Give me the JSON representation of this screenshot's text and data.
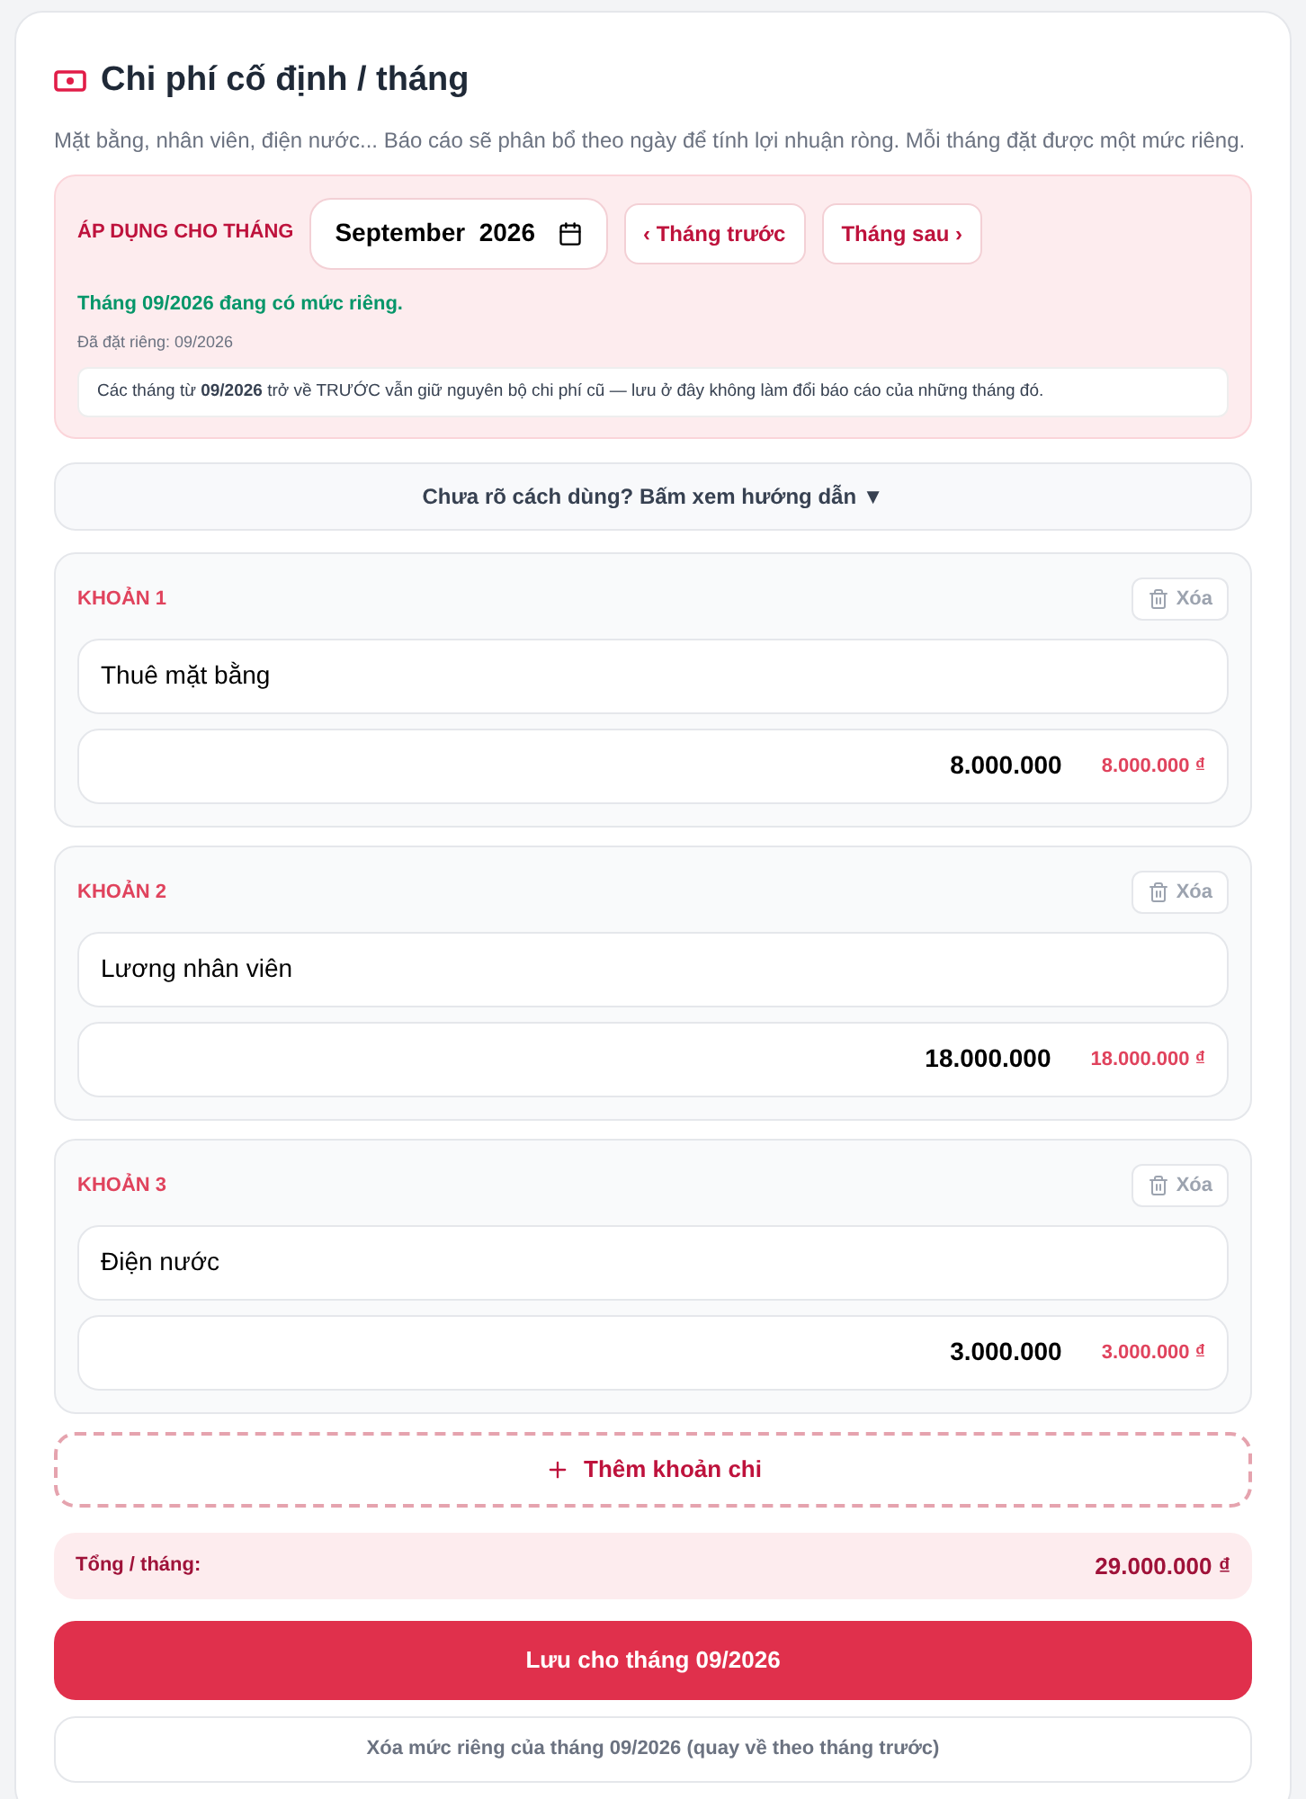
{
  "title": "Chi phí cố định / tháng",
  "description": "Mặt bằng, nhân viên, điện nước... Báo cáo sẽ phân bổ theo ngày để tính lợi nhuận ròng. Mỗi tháng đặt được một mức riêng.",
  "month_panel": {
    "label": "ÁP DỤNG CHO THÁNG",
    "month_value": "September  2026",
    "prev_button": "‹ Tháng trước",
    "next_button": "Tháng sau ›",
    "status": "Tháng 09/2026 đang có mức riêng.",
    "set_note": "Đã đặt riêng: 09/2026",
    "notice": "Các tháng từ **09/2026** trở về TRƯỚC vẫn giữ nguyên bộ chi phí cũ — lưu ở đây không làm đổi báo cáo của những tháng đó."
  },
  "guide_toggle": {
    "label": "Chưa rõ cách dùng? Bấm xem hướng dẫn ▼"
  },
  "items": [
    {
      "label": "KHOẢN 1",
      "delete": "Xóa",
      "name": "Thuê mặt bằng",
      "amount": "8.000.000",
      "formatted": "8.000.000 ₫"
    },
    {
      "label": "KHOẢN 2",
      "delete": "Xóa",
      "name": "Lương nhân viên",
      "amount": "18.000.000",
      "formatted": "18.000.000 ₫"
    },
    {
      "label": "KHOẢN 3",
      "delete": "Xóa",
      "name": "Điện nước",
      "amount": "3.000.000",
      "formatted": "3.000.000 ₫"
    }
  ],
  "add_button": "Thêm khoản chi",
  "total": {
    "label": "Tổng / tháng:",
    "value": "29.000.000 ₫"
  },
  "save_button": "Lưu cho tháng 09/2026",
  "clear_button": "Xóa mức riêng của tháng 09/2026 (quay về theo tháng trước)"
}
